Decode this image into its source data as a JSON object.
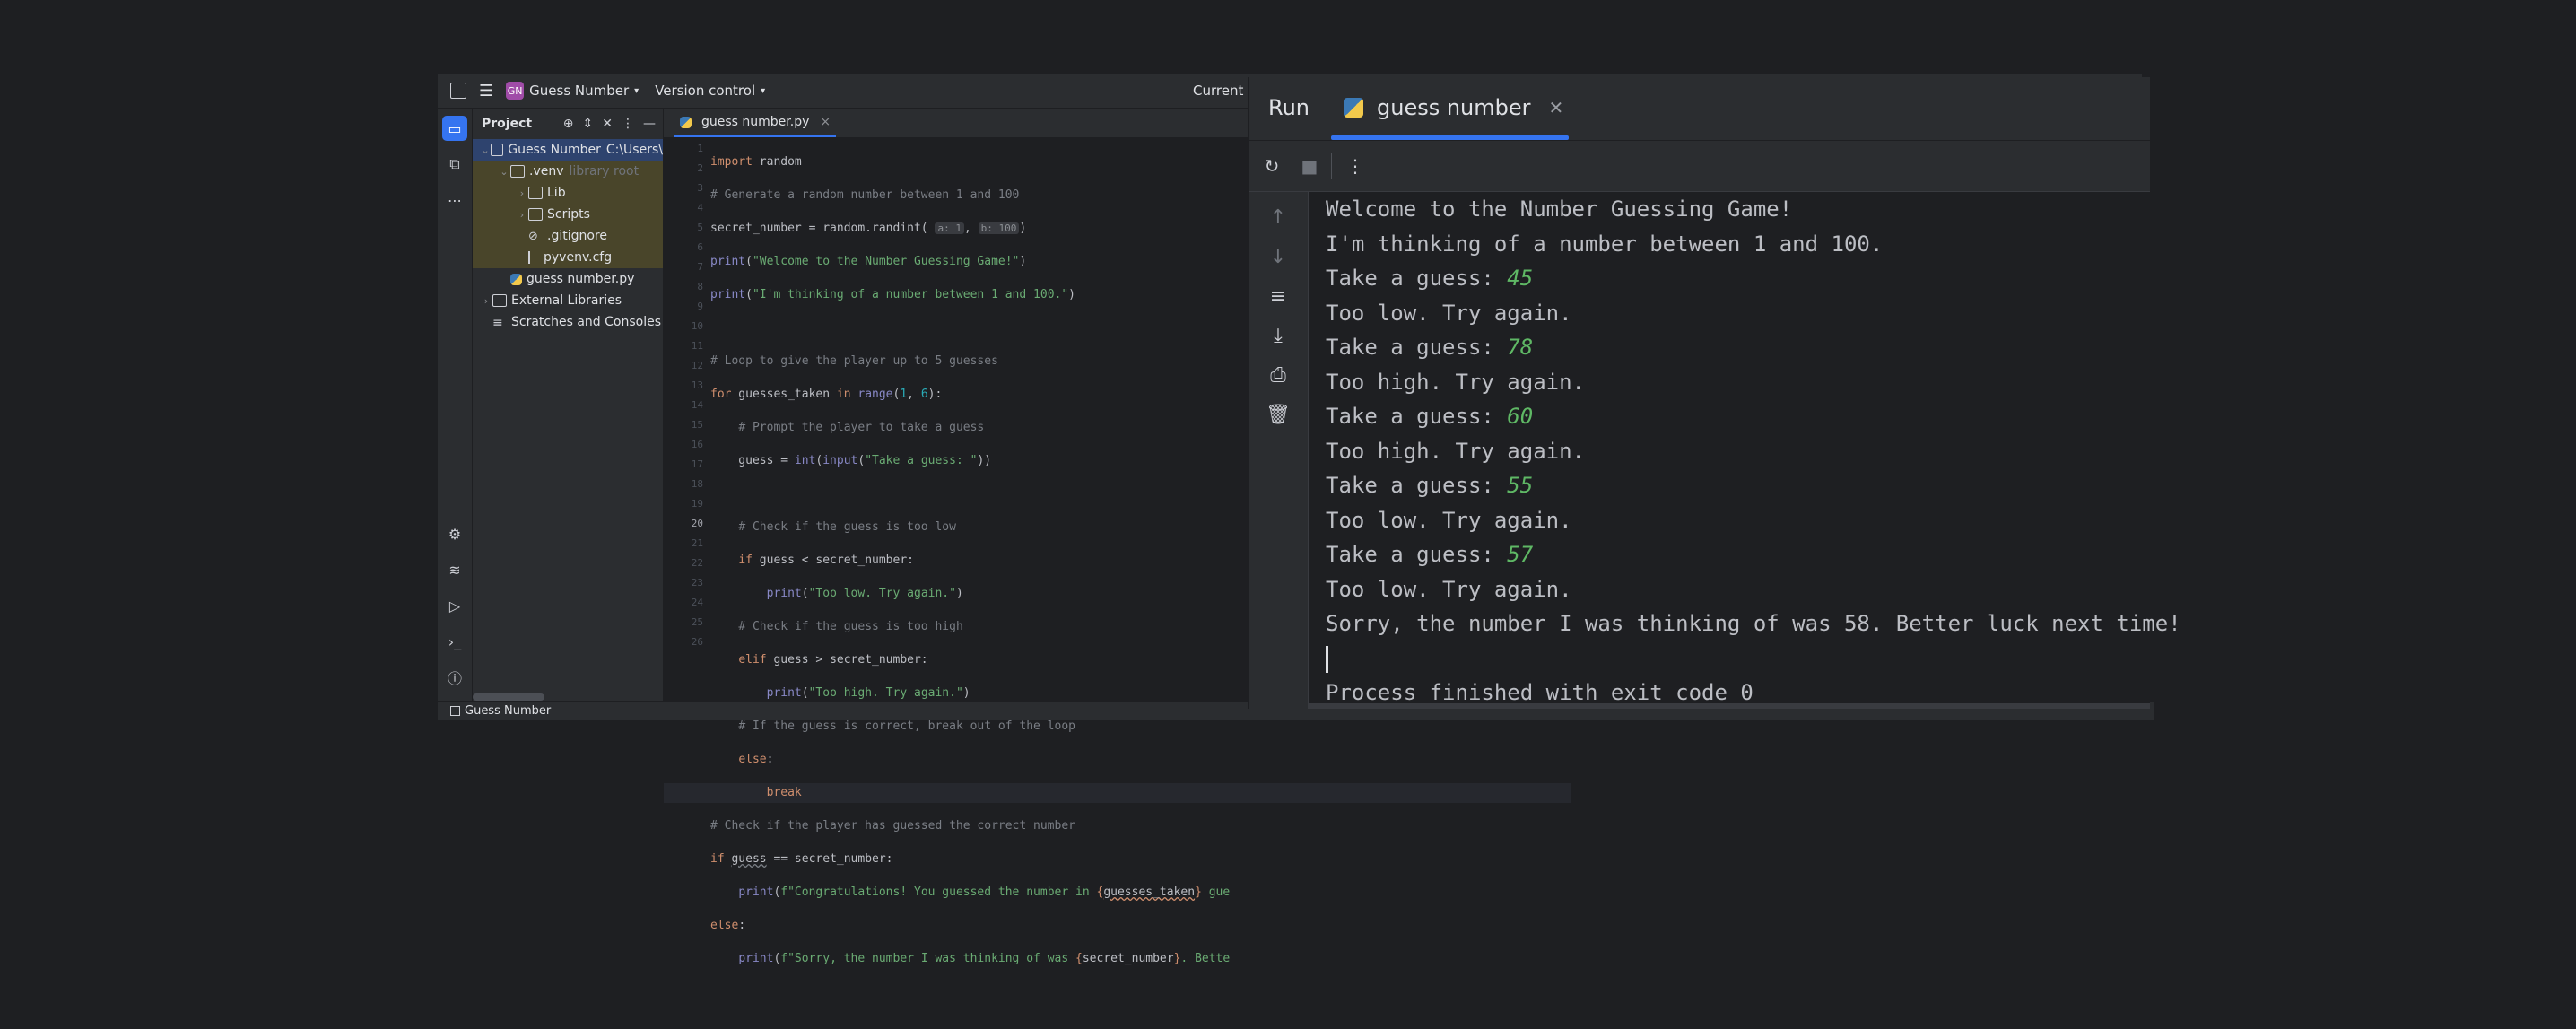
{
  "titlebar": {
    "project_badge": "GN",
    "project_name": "Guess Number",
    "vcs": "Version control",
    "current": "Current"
  },
  "project_panel": {
    "title": "Project",
    "tree": [
      {
        "label": "Guess Number",
        "extra": "C:\\Users\\",
        "kind": "folder",
        "depth": 0,
        "expanded": true,
        "selected": true
      },
      {
        "label": ".venv",
        "extra": "library root",
        "kind": "folder",
        "depth": 1,
        "expanded": true
      },
      {
        "label": "Lib",
        "extra": "",
        "kind": "folder",
        "depth": 2,
        "expanded": false
      },
      {
        "label": "Scripts",
        "extra": "",
        "kind": "folder",
        "depth": 2,
        "expanded": false
      },
      {
        "label": ".gitignore",
        "extra": "",
        "kind": "ignore",
        "depth": 2
      },
      {
        "label": "pyvenv.cfg",
        "extra": "",
        "kind": "file",
        "depth": 2
      },
      {
        "label": "guess number.py",
        "extra": "",
        "kind": "python",
        "depth": 1
      },
      {
        "label": "External Libraries",
        "extra": "",
        "kind": "library",
        "depth": 0,
        "expanded": false
      },
      {
        "label": "Scratches and Consoles",
        "extra": "",
        "kind": "scratch",
        "depth": 0
      }
    ]
  },
  "editor": {
    "tab_label": "guess number.py",
    "current_line": 20,
    "line_numbers": [
      "1",
      "2",
      "3",
      "4",
      "5",
      "6",
      "7",
      "8",
      "9",
      "10",
      "11",
      "12",
      "13",
      "14",
      "15",
      "16",
      "17",
      "18",
      "19",
      "20",
      "21",
      "22",
      "23",
      "24",
      "25",
      "26"
    ]
  },
  "statusbar": {
    "path": "Guess Number"
  },
  "run_panel": {
    "title": "Run",
    "tab_label": "guess number",
    "console": [
      {
        "text": "Welcome to the Number Guessing Game!",
        "input": ""
      },
      {
        "text": "I'm thinking of a number between 1 and 100.",
        "input": ""
      },
      {
        "text": "Take a guess: ",
        "input": "45"
      },
      {
        "text": "Too low. Try again.",
        "input": ""
      },
      {
        "text": "Take a guess: ",
        "input": "78"
      },
      {
        "text": "Too high. Try again.",
        "input": ""
      },
      {
        "text": "Take a guess: ",
        "input": "60"
      },
      {
        "text": "Too high. Try again.",
        "input": ""
      },
      {
        "text": "Take a guess: ",
        "input": "55"
      },
      {
        "text": "Too low. Try again.",
        "input": ""
      },
      {
        "text": "Take a guess: ",
        "input": "57"
      },
      {
        "text": "Too low. Try again.",
        "input": ""
      },
      {
        "text": "Sorry, the number I was thinking of was 58. Better luck next time!",
        "input": ""
      }
    ],
    "exit_message": "Process finished with exit code 0"
  },
  "colors": {
    "accent": "#3574f0",
    "background": "#1e1f22",
    "panel": "#2b2d30",
    "input_text": "#5fb865"
  }
}
